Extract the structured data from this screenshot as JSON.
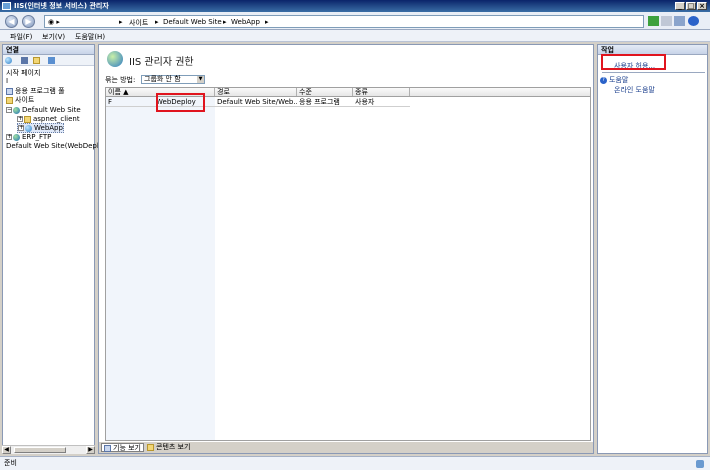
{
  "window": {
    "title": "IIS(인터넷 정보 서비스) 관리자",
    "buttons": [
      "_",
      "□",
      "×"
    ]
  },
  "address": {
    "breadcrumb": [
      "사이트",
      "Default Web Site",
      "WebApp"
    ],
    "separator": "▸"
  },
  "menu": {
    "items": [
      "파일(F)",
      "보기(V)",
      "도움말(H)"
    ]
  },
  "connections": {
    "header": "연결",
    "tree": [
      {
        "label": "시작 페이지",
        "icon": "start-page-icon"
      },
      {
        "label": "I",
        "icon": ""
      },
      {
        "label": "응용 프로그램 풀",
        "icon": "app-pool-icon"
      },
      {
        "label": "사이트",
        "icon": "folder-icon"
      },
      {
        "label": "Default Web Site",
        "icon": "globe-icon"
      },
      {
        "label": "aspnet_client",
        "icon": "folder-icon"
      },
      {
        "label": "WebApp",
        "icon": "web-app-icon"
      },
      {
        "label": "ERP_FTP",
        "icon": "globe-icon"
      },
      {
        "label": "Default Web Site(WebDeploy",
        "icon": ""
      }
    ]
  },
  "main": {
    "title": "IIS 관리자 권한",
    "group_by_label": "묶는 방법:",
    "group_by_value": "그룹화 안 함",
    "columns": [
      "이름 ▲",
      "경로",
      "수준",
      "종류"
    ],
    "rows": [
      {
        "name_prefix": "F",
        "name": "WebDeploy",
        "path": "Default Web Site/Web...",
        "level": "응용 프로그램",
        "type": "사용자"
      }
    ],
    "view_tabs": [
      "기능 보기",
      "콘텐츠 보기"
    ]
  },
  "actions": {
    "header": "작업",
    "items": [
      "사용자 허용...",
      "도움말",
      "온라인 도움말"
    ]
  },
  "status": {
    "text": "준비"
  },
  "colors": {
    "highlight": "#e0141e",
    "title_bar": "#0a246a",
    "link": "#1a3e8c"
  }
}
